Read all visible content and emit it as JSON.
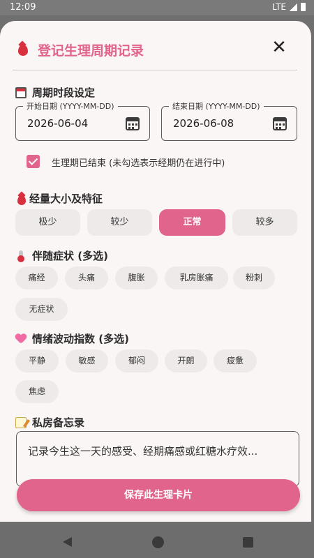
{
  "status": {
    "time": "12:09",
    "network": "LTE"
  },
  "header": {
    "title": "登记生理周期记录",
    "close_icon": "close-icon"
  },
  "period": {
    "section_title": "周期时段设定",
    "start": {
      "label": "开始日期 (YYYY-MM-DD)",
      "value": "2026-06-04"
    },
    "end": {
      "label": "结束日期 (YYYY-MM-DD)",
      "value": "2026-06-08"
    },
    "ended_checkbox": {
      "checked": true,
      "label": "生理期已结束 (未勾选表示经期仍在进行中)"
    }
  },
  "flow": {
    "section_title": "经量大小及特征",
    "options": [
      "极少",
      "较少",
      "正常",
      "较多"
    ],
    "selected": "正常"
  },
  "symptoms": {
    "section_title": "伴随症状 (多选)",
    "options": [
      "痛经",
      "头痛",
      "腹胀",
      "乳房胀痛",
      "粉刺",
      "无症状"
    ]
  },
  "moods": {
    "section_title": "情绪波动指数 (多选)",
    "options": [
      "平静",
      "敏感",
      "郁闷",
      "开朗",
      "疲惫",
      "焦虑"
    ]
  },
  "memo": {
    "section_title": "私房备忘录",
    "placeholder": "记录今生这一天的感受、经期痛感或红糖水疗效..."
  },
  "actions": {
    "save_label": "保存此生理卡片"
  },
  "colors": {
    "accent": "#e0648c",
    "chip_bg": "#efeaea",
    "sheet_bg": "#fbf6f6"
  }
}
